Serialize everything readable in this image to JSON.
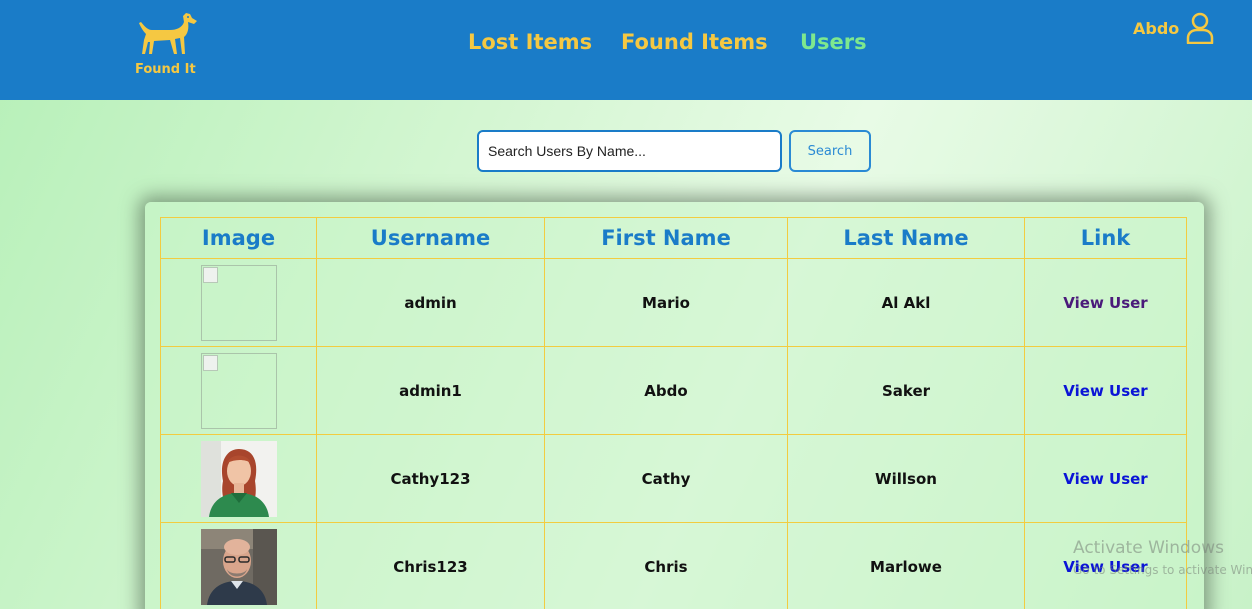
{
  "brand": {
    "name": "Found It",
    "logo_icon": "dog-icon",
    "color": "#f5c842"
  },
  "nav": {
    "background": "#1a7cc8",
    "links": [
      {
        "label": "Lost Items",
        "active": false
      },
      {
        "label": "Found Items",
        "active": false
      },
      {
        "label": "Users",
        "active": true
      }
    ],
    "active_color": "#7ee88e"
  },
  "user": {
    "name": "Abdo",
    "icon": "user-icon"
  },
  "search": {
    "placeholder": "Search Users By Name...",
    "value": "",
    "button_label": "Search"
  },
  "table": {
    "columns": [
      "Image",
      "Username",
      "First Name",
      "Last Name",
      "Link"
    ],
    "rows": [
      {
        "image": "broken",
        "username": "admin",
        "first_name": "Mario",
        "last_name": "Al Akl",
        "link": "View User",
        "link_state": "visited"
      },
      {
        "image": "broken",
        "username": "admin1",
        "first_name": "Abdo",
        "last_name": "Saker",
        "link": "View User",
        "link_state": "unvisited"
      },
      {
        "image": "photo-woman",
        "username": "Cathy123",
        "first_name": "Cathy",
        "last_name": "Willson",
        "link": "View User",
        "link_state": "unvisited"
      },
      {
        "image": "photo-man",
        "username": "Chris123",
        "first_name": "Chris",
        "last_name": "Marlowe",
        "link": "View User",
        "link_state": "unvisited"
      }
    ],
    "border_color": "#f2cc40",
    "header_color": "#1a7cc8"
  },
  "watermark": {
    "title": "Activate Windows",
    "subtitle": "Go to Settings to activate Windows."
  }
}
